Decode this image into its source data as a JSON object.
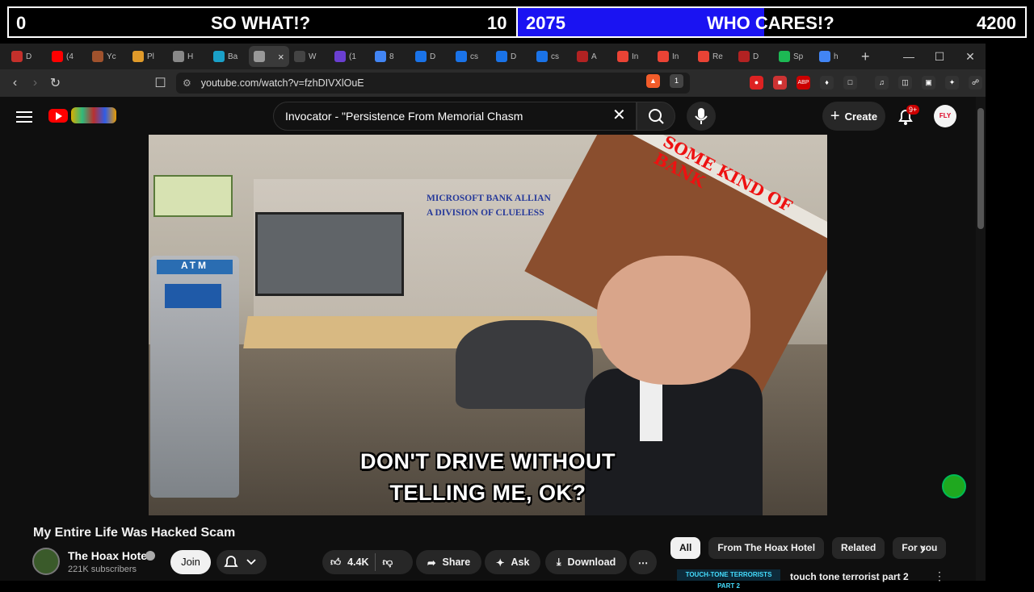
{
  "scoreboard": {
    "left_score": "0",
    "left_label": "SO WHAT!?",
    "left_count": "10",
    "right_score": "2075",
    "right_label": "WHO CARES!?",
    "right_count": "4200",
    "right_fill_color": "#1a13f2"
  },
  "tabs": [
    {
      "label": "D",
      "color": "#c4302b"
    },
    {
      "label": "(4",
      "color": "#ff0000"
    },
    {
      "label": "Yc",
      "color": "#a0522d"
    },
    {
      "label": "Pl",
      "color": "#e09a2a"
    },
    {
      "label": "H",
      "color": "#888888"
    },
    {
      "label": "Ba",
      "color": "#1aa0c8"
    },
    {
      "label": "",
      "color": "#999999",
      "active": true
    },
    {
      "label": "W",
      "color": "#444444"
    },
    {
      "label": "(1",
      "color": "#6a3fd1"
    },
    {
      "label": "8",
      "color": "#4285f4"
    },
    {
      "label": "D",
      "color": "#1a73e8"
    },
    {
      "label": "cs",
      "color": "#1a73e8"
    },
    {
      "label": "D",
      "color": "#1a73e8"
    },
    {
      "label": "cs",
      "color": "#1a73e8"
    },
    {
      "label": "A",
      "color": "#b22222"
    },
    {
      "label": "In",
      "color": "#ea4335"
    },
    {
      "label": "In",
      "color": "#ea4335"
    },
    {
      "label": "Re",
      "color": "#ea4335"
    },
    {
      "label": "D",
      "color": "#b22222"
    },
    {
      "label": "Sp",
      "color": "#1db954"
    },
    {
      "label": "h",
      "color": "#4285f4"
    }
  ],
  "browser": {
    "url": "youtube.com/watch?v=fzhDIVXlOuE",
    "new_tab": "+",
    "brave_badge": "1"
  },
  "youtube": {
    "search_value": "Invocator - \"Persistence From Memorial Chasm",
    "create_label": "Create",
    "notif_badge": "9+",
    "avatar_text": "FLY",
    "video": {
      "bank_sign": "SOME KIND OF BANK",
      "sign_line1": "MICROSOFT BANK ALLIAN",
      "sign_line2": "A DIVISION OF CLUELESS",
      "atm_label": "ATM",
      "caption_line1": "DON'T DRIVE WITHOUT",
      "caption_line2": "TELLING ME, OK?"
    },
    "title": "My Entire Life Was Hacked Scam",
    "channel_name": "The Hoax Hotel",
    "subscribers": "221K subscribers",
    "join_label": "Join",
    "likes": "4.4K",
    "share_label": "Share",
    "ask_label": "Ask",
    "download_label": "Download",
    "chips": [
      "All",
      "From The Hoax Hotel",
      "Related",
      "For you"
    ],
    "rec_thumb_text": "TOUCH-TONE TERRORISTS PART 2",
    "rec_title": "touch tone terrorist part 2"
  }
}
